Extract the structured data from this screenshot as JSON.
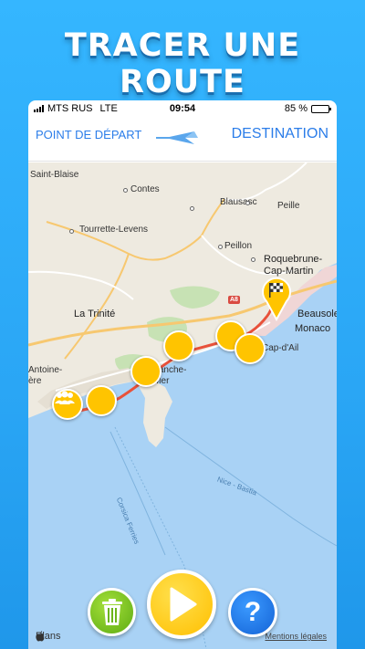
{
  "promo": {
    "title": "TRACER UNE ROUTE"
  },
  "status_bar": {
    "carrier": "MTS RUS",
    "network": "LTE",
    "time": "09:54",
    "battery": "85 %",
    "battery_level": 0.85
  },
  "route_bar": {
    "start_label": "POINT DE DÉPART",
    "destination_label": "DESTINATION"
  },
  "map": {
    "places": {
      "saint_blaise": "Saint-Blaise",
      "contes": "Contes",
      "blausasc": "Blausasc",
      "peille": "Peille",
      "tourrette": "Tourrette-Levens",
      "peillon": "Peillon",
      "roquebrune": "Roquebrune-",
      "cap_martin": "Cap-Martin",
      "beausoleil": "Beausoleil",
      "la_trinite": "La Trinité",
      "monaco": "Monaco",
      "cap_dail": "Cap-d'Ail",
      "antoine": "Antoine-",
      "ere": "ère",
      "villefranche": "Villefranche-",
      "sur_mer": "sur-Mer",
      "nice_bastia": "Nice - Bastia",
      "corsica_ferries": "Corsica Ferries"
    },
    "highway_label": "A8",
    "attribution": "Plans",
    "legal": "Mentions légales"
  },
  "controls": {
    "help_label": "?"
  },
  "colors": {
    "accent": "#2b7de9",
    "waypoint": "#ffc400",
    "route": "#e8513a",
    "background": "#2aa6f5"
  }
}
